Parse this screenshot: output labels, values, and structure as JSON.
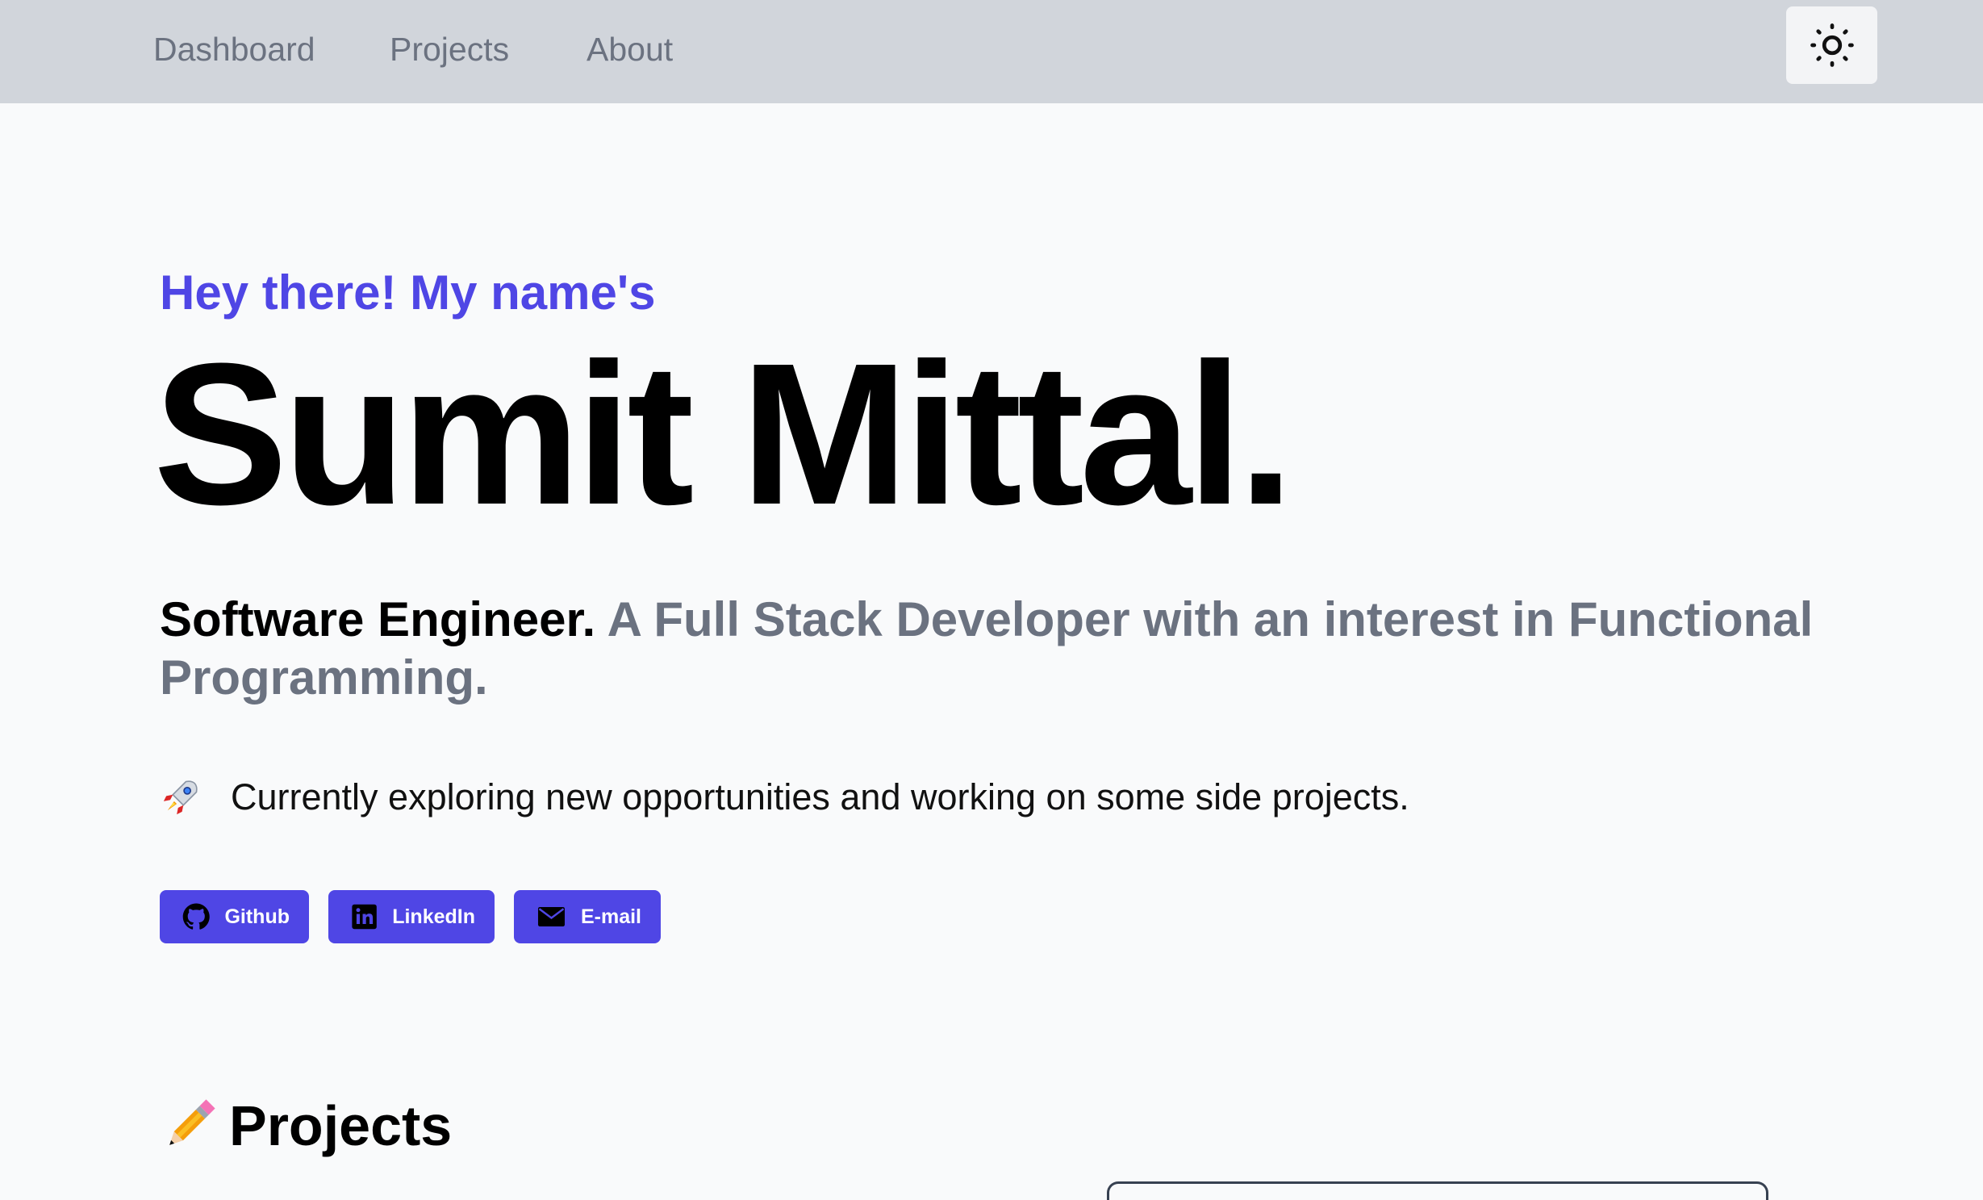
{
  "nav": {
    "links": [
      "Dashboard",
      "Projects",
      "About"
    ],
    "theme_toggle_icon": "sun-icon"
  },
  "hero": {
    "greeting": "Hey there! My name's",
    "name": "Sumit Mittal.",
    "role": "Software Engineer.",
    "description": "A Full Stack Developer with an interest in Functional Programming.",
    "status_emoji": "rocket-icon",
    "status": "Currently exploring new opportunities and working on some side projects."
  },
  "social": [
    {
      "label": "Github",
      "icon": "github-icon"
    },
    {
      "label": "LinkedIn",
      "icon": "linkedin-icon"
    },
    {
      "label": "E-mail",
      "icon": "mail-icon"
    }
  ],
  "projects": {
    "emoji": "pencil-icon",
    "heading": "Projects"
  },
  "colors": {
    "accent": "#4f46e5",
    "navbar": "#d1d5db",
    "muted_text": "#6b7280",
    "background": "#f9fafb"
  }
}
